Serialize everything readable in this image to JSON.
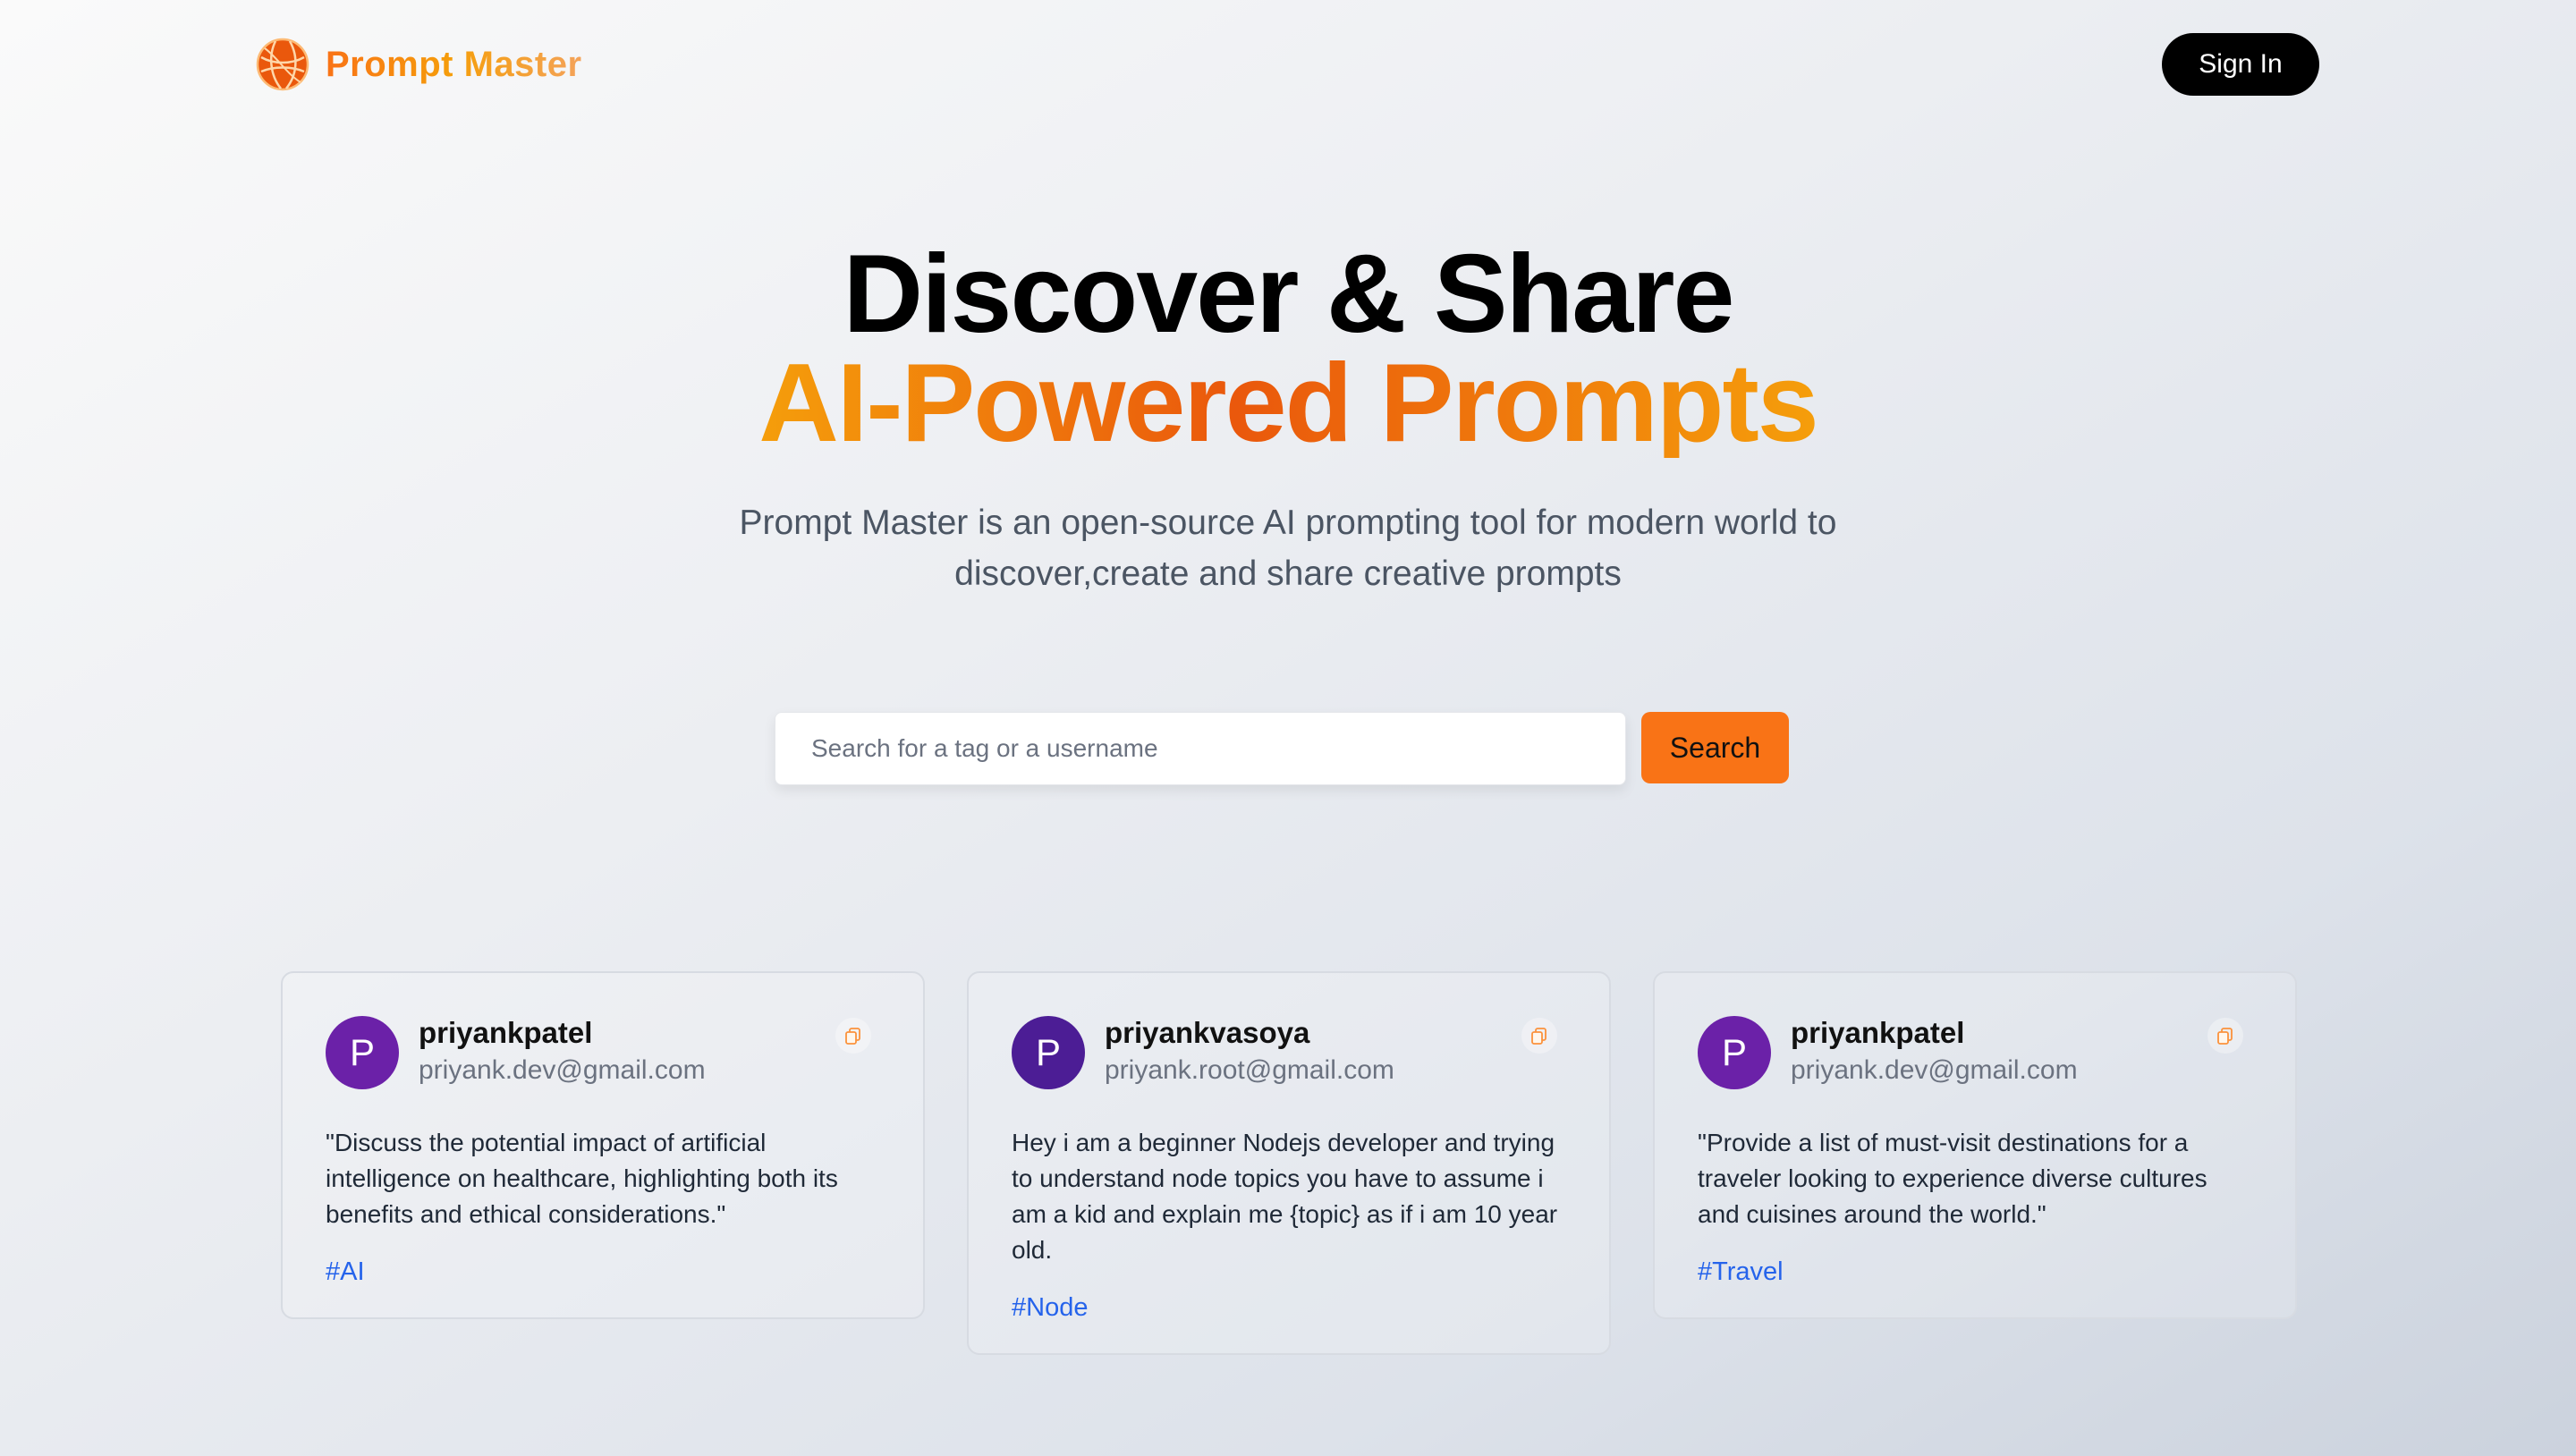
{
  "brand": {
    "name": "Prompt Master",
    "logo_icon": "globe-icon",
    "color_primary": "#f97316"
  },
  "nav": {
    "signin_label": "Sign In"
  },
  "hero": {
    "title_line1": "Discover & Share",
    "title_line2": "AI-Powered Prompts",
    "description": "Prompt Master is an open-source AI prompting tool for modern world to discover,create and share creative prompts"
  },
  "search": {
    "placeholder": "Search for a tag or a username",
    "value": "",
    "button_label": "Search"
  },
  "prompts": [
    {
      "avatar_letter": "P",
      "avatar_color": "#6b21a8",
      "username": "priyankpatel",
      "email": "priyank.dev@gmail.com",
      "text": "\"Discuss the potential impact of artificial intelligence on healthcare, highlighting both its benefits and ethical considerations.\"",
      "tag": "#AI",
      "copy_icon": "copy-icon"
    },
    {
      "avatar_letter": "P",
      "avatar_color": "#4c1d95",
      "username": "priyankvasoya",
      "email": "priyank.root@gmail.com",
      "text": "Hey i am a beginner Nodejs developer and trying to understand node topics you have to assume i am a kid and explain me {topic} as if i am 10 year old.",
      "tag": "#Node",
      "copy_icon": "copy-icon"
    },
    {
      "avatar_letter": "P",
      "avatar_color": "#6b21a8",
      "username": "priyankpatel",
      "email": "priyank.dev@gmail.com",
      "text": "\"Provide a list of must-visit destinations for a traveler looking to experience diverse cultures and cuisines around the world.\"",
      "tag": "#Travel",
      "copy_icon": "copy-icon"
    }
  ]
}
